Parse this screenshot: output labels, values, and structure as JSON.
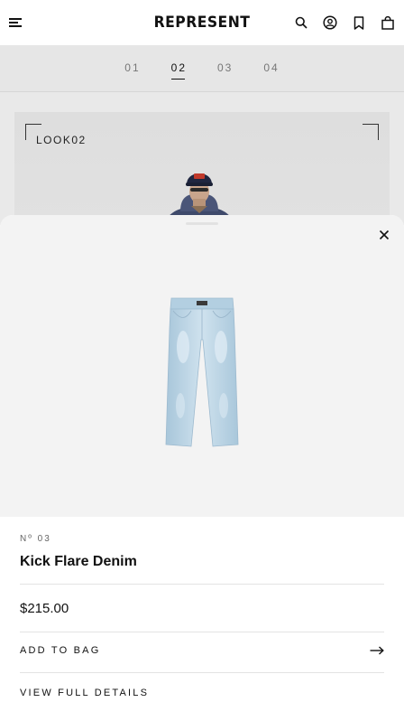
{
  "header": {
    "brand": "REPRESENT",
    "icons": [
      "menu-icon",
      "search-icon",
      "account-icon",
      "bookmark-icon",
      "bag-icon"
    ]
  },
  "look_tabs": [
    {
      "label": "01",
      "active": false
    },
    {
      "label": "02",
      "active": true
    },
    {
      "label": "03",
      "active": false
    },
    {
      "label": "04",
      "active": false
    }
  ],
  "look": {
    "label": "LOOK02"
  },
  "product_sheet": {
    "number": "Nº 03",
    "name": "Kick Flare Denim",
    "price": "$215.00",
    "add_to_bag_label": "ADD TO BAG",
    "view_details_label": "VIEW FULL DETAILS"
  },
  "colors": {
    "accent": "#111111",
    "sheet_image_bg": "#f3f3f3",
    "page_bg": "#e9e9e9",
    "denim": "#b8d4e6"
  }
}
